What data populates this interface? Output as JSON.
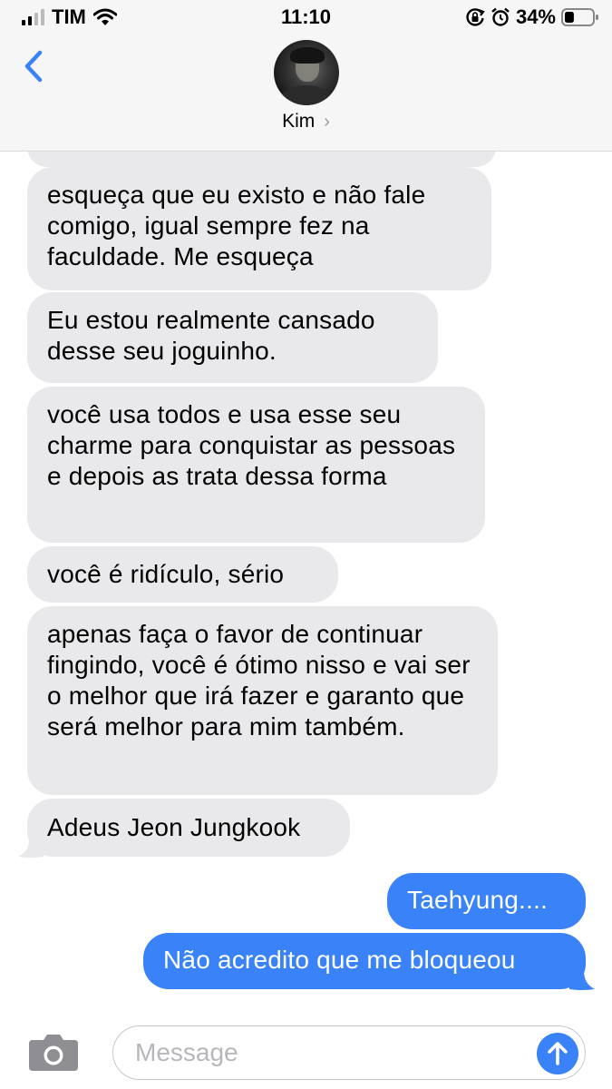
{
  "status_bar": {
    "carrier": "TIM",
    "time": "11:10",
    "battery_percent": "34%",
    "battery_level": 0.34,
    "icons": [
      "signal-icon",
      "wifi-icon",
      "rotation-lock-icon",
      "alarm-icon",
      "battery-icon"
    ]
  },
  "header": {
    "contact_name": "Kim",
    "chevron": "›",
    "icons": [
      "back-chevron-icon",
      "avatar"
    ]
  },
  "messages": [
    {
      "direction": "in",
      "text": "esqueça que eu existo e não fale comigo, igual sempre fez na faculdade. Me esqueça"
    },
    {
      "direction": "in",
      "text": "Eu estou realmente cansado desse seu joguinho."
    },
    {
      "direction": "in",
      "text": "você usa todos e usa esse seu charme para conquistar as pessoas e depois as trata dessa forma"
    },
    {
      "direction": "in",
      "text": "você é ridículo, sério"
    },
    {
      "direction": "in",
      "text": "apenas faça o favor de continuar fingindo, você é ótimo nisso e vai ser o melhor que irá fazer e garanto que será melhor para mim também."
    },
    {
      "direction": "in",
      "text": "Adeus Jeon Jungkook"
    },
    {
      "direction": "out",
      "text": "Taehyung...."
    },
    {
      "direction": "out",
      "text": "Não acredito que me bloqueou"
    }
  ],
  "composer": {
    "placeholder": "Message",
    "icons": [
      "camera-icon",
      "send-arrow-icon"
    ]
  },
  "colors": {
    "incoming_bubble": "#e9e9eb",
    "outgoing_bubble": "#3a82f7",
    "accent": "#3a82f7",
    "header_bg": "#f6f6f6"
  }
}
